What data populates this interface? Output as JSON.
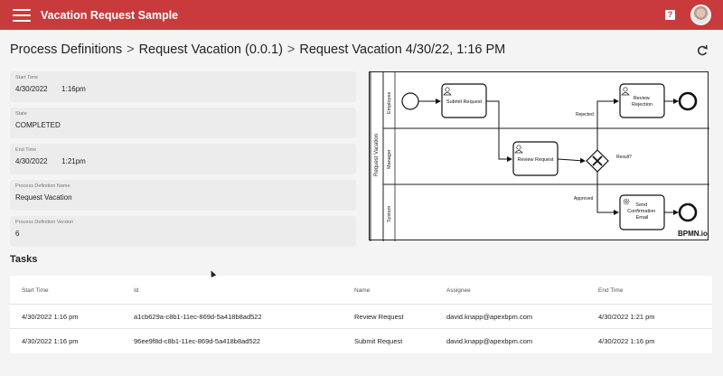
{
  "app": {
    "title": "Vacation Request Sample",
    "help_label": "?"
  },
  "breadcrumb": {
    "items": [
      "Process Definitions",
      "Request Vacation (0.0.1)",
      "Request Vacation 4/30/22, 1:16 PM"
    ],
    "separator": ">"
  },
  "details": [
    {
      "label": "Start Time",
      "value": "4/30/2022       1:16pm"
    },
    {
      "label": "State",
      "value": "COMPLETED"
    },
    {
      "label": "End Time",
      "value": "4/30/2022       1:21pm"
    },
    {
      "label": "Process Definition Name",
      "value": "Request Vacation"
    },
    {
      "label": "Process Definition Version",
      "value": "6"
    }
  ],
  "diagram": {
    "pool_label": "Request Vacation",
    "lanes": [
      "Employee",
      "Manager",
      "System"
    ],
    "tasks": {
      "submit": "Submit Request",
      "review": "Review Request",
      "rejection": [
        "Review",
        "Rejection"
      ],
      "confirm": [
        "Send",
        "Confirmation",
        "Email"
      ]
    },
    "gateway_label": "Result?",
    "flow_labels": {
      "rejected": "Rejected",
      "approved": "Approved"
    },
    "watermark": "BPMN.io"
  },
  "tasks": {
    "title": "Tasks",
    "columns": [
      "Start Time",
      "Id",
      "Name",
      "Assignee",
      "End Time"
    ],
    "rows": [
      [
        "4/30/2022 1:16 pm",
        "a1cb629a-c8b1-11ec-869d-5a418b8ad522",
        "Review Request",
        "david.knapp@apexbpm.com",
        "4/30/2022 1:21 pm"
      ],
      [
        "4/30/2022 1:16 pm",
        "96ee9f8d-c8b1-11ec-869d-5a418b8ad522",
        "Submit Request",
        "david.knapp@apexbpm.com",
        "4/30/2022 1:16 pm"
      ]
    ]
  },
  "colors": {
    "header_bg": "#c93a3d",
    "page_bg": "#f4f4f4",
    "field_bg": "#ececec"
  },
  "icons": {
    "menu": "hamburger-menu-icon",
    "help": "help-icon",
    "refresh": "refresh-icon",
    "user_task": "user-task-icon",
    "service_task": "gear-icon"
  }
}
